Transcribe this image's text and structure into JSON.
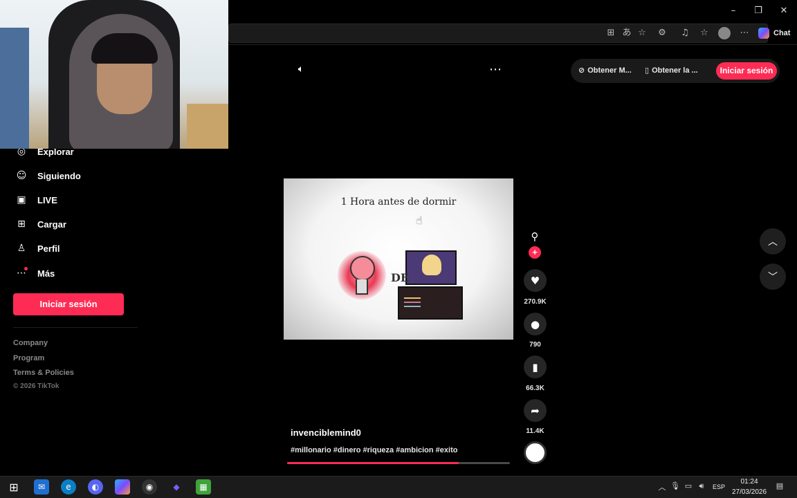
{
  "browser": {
    "minimize_icon": "minimize-icon",
    "restore_icon": "restore-icon",
    "close_icon": "close-icon",
    "chat_label": "Chat"
  },
  "sidebar": {
    "items": [
      {
        "label": "Explorar",
        "icon": "compass-icon"
      },
      {
        "label": "Siguiendo",
        "icon": "following-icon"
      },
      {
        "label": "LIVE",
        "icon": "live-icon"
      },
      {
        "label": "Cargar",
        "icon": "upload-icon"
      },
      {
        "label": "Perfil",
        "icon": "profile-icon"
      },
      {
        "label": "Más",
        "icon": "more-icon"
      }
    ],
    "login_label": "Iniciar sesión",
    "footer": [
      "Company",
      "Program",
      "Terms & Policies"
    ],
    "copyright": "© 2026 TikTok"
  },
  "topbar": {
    "get_coins_label": "Obtener M...",
    "get_app_label": "Obtener la ...",
    "login_label": "Iniciar sesión"
  },
  "video": {
    "overlay_text": "1 Hora antes de dormir",
    "overlay_word": "DE",
    "author": "invenciblemind0",
    "caption": "#millonario #dinero #riqueza #ambicion #exito",
    "progress": 0.77
  },
  "actions": {
    "likes": "270.9K",
    "comments": "790",
    "saves": "66.3K",
    "shares": "11.4K"
  },
  "taskbar": {
    "language": "ESP",
    "time": "01:24",
    "date": "27/03/2026"
  },
  "colors": {
    "accent": "#fe2c55",
    "background": "#000000"
  }
}
